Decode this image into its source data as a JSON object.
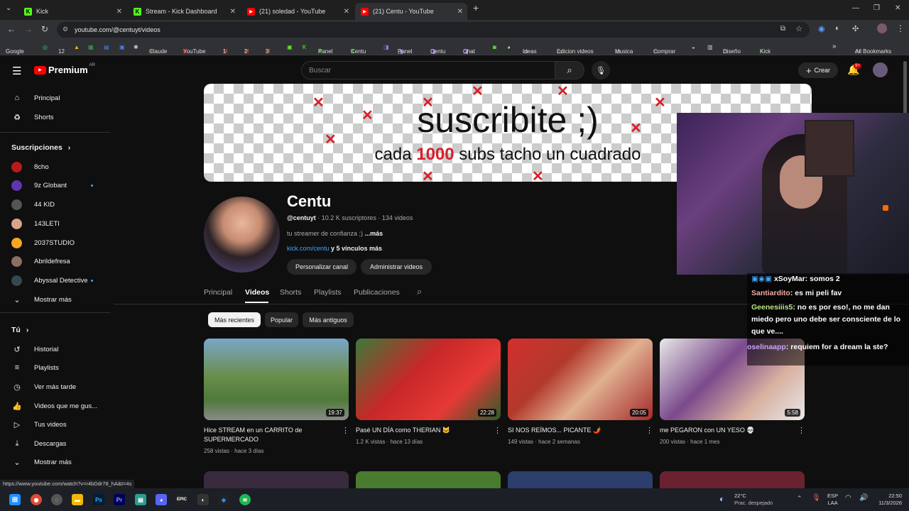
{
  "browser": {
    "tabs": [
      {
        "label": "Kick",
        "icon": "kick-icon"
      },
      {
        "label": "Stream - Kick Dashboard",
        "icon": "kick-icon"
      },
      {
        "label": "(21) soledad - YouTube",
        "icon": "youtube-icon"
      },
      {
        "label": "(21) Centu - YouTube",
        "icon": "youtube-icon",
        "active": true
      }
    ],
    "url": "youtube.com/@centuyt/videos",
    "bookmarks": [
      "Google",
      "12",
      "Claude",
      "YouTube",
      "1",
      "2",
      "3",
      "Panel",
      "Centu",
      "Panel",
      "Centu",
      "Chat",
      "Ideas",
      "Edicion videos",
      "Musica",
      "Comprar",
      "Diseño",
      "Kick"
    ],
    "all_bookmarks": "All Bookmarks"
  },
  "youtube": {
    "logo": "Premium",
    "region": "AR",
    "search_placeholder": "Buscar",
    "create_label": "Crear",
    "notifications_badge": "9+",
    "sidebar": {
      "main": [
        "Principal",
        "Shorts"
      ],
      "subs_header": "Suscripciones",
      "subs": [
        {
          "name": "8cho",
          "color": "#b71c1c",
          "dot": false
        },
        {
          "name": "9z Globant",
          "color": "#5e35b1",
          "dot": true
        },
        {
          "name": "44 KID",
          "color": "#555555",
          "dot": false
        },
        {
          "name": "143LETI",
          "color": "#d7a48c",
          "dot": false
        },
        {
          "name": "2037STUDIO",
          "color": "#f5a623",
          "dot": false
        },
        {
          "name": "Abrildefresa",
          "color": "#8d6e63",
          "dot": false
        },
        {
          "name": "Abyssal Detective",
          "color": "#37474f",
          "dot": true
        }
      ],
      "show_more": "Mostrar más",
      "you_header": "Tú",
      "you_items": [
        "Historial",
        "Playlists",
        "Ver más tarde",
        "Videos que me gus...",
        "Tus videos",
        "Descargas",
        "Mostrar más"
      ]
    },
    "banner": {
      "title": "suscribite ;)",
      "sub_pre": "cada ",
      "sub_num": "1000",
      "sub_post": " subs tacho un cuadrado"
    },
    "channel": {
      "name": "Centu",
      "handle": "@centuyt",
      "meta": " · 10.2 K suscriptores · 134 videos",
      "desc": "tu streamer de confianza ;) ",
      "desc_more": "...más",
      "link": "kick.com/centu",
      "link_more": " y 5 vínculos más",
      "customize": "Personalizar canal",
      "manage": "Administrar videos"
    },
    "tabs": [
      "Principal",
      "Videos",
      "Shorts",
      "Playlists",
      "Publicaciones"
    ],
    "chips": [
      "Más recientes",
      "Popular",
      "Más antiguos"
    ],
    "videos": [
      {
        "title": "Hice STREAM en un CARRITO de SUPERMERCADO",
        "views": "258 vistas",
        "age": "hace 3 días",
        "duration": "19:37",
        "color": "#4f7a3a"
      },
      {
        "title": "Pasé UN DÍA como THERIAN 🐱",
        "views": "1.2 K vistas",
        "age": "hace 13 días",
        "duration": "22:28",
        "color": "#c62828"
      },
      {
        "title": "SI NOS REÍMOS... PICANTE 🌶️",
        "views": "149 vistas",
        "age": "hace 2 semanas",
        "duration": "20:05",
        "color": "#b23a2b"
      },
      {
        "title": "me PEGARON con UN YESO 💀",
        "views": "200 vistas",
        "age": "hace 1 mes",
        "duration": "5:58",
        "color": "#7b4a8c"
      }
    ]
  },
  "stream_chat": [
    {
      "user": "xSoyMar",
      "color": "#ffffff",
      "msg": ": somos 2"
    },
    {
      "user": "Santiardito",
      "color": "#f4a9a0",
      "msg": ": es mi peli fav"
    },
    {
      "user": "Geenesiiis5",
      "color": "#b8e986",
      "msg": ": no es por eso!, no me dan miedo pero uno debe ser consciente de lo que ve...."
    },
    {
      "user": "oselinaapp",
      "color": "#c7a6f3",
      "msg": ": requiem for a dream la ste?"
    }
  ],
  "status_url": "https://www.youtube.com/watch?v=r4bDdr78_hA&t=4s",
  "taskbar": {
    "weather_temp": "22°C",
    "weather_desc": "Prac. despejado",
    "lang1": "ESP",
    "lang2": "LAA",
    "time": "22:50",
    "date": "11/3/2026"
  }
}
